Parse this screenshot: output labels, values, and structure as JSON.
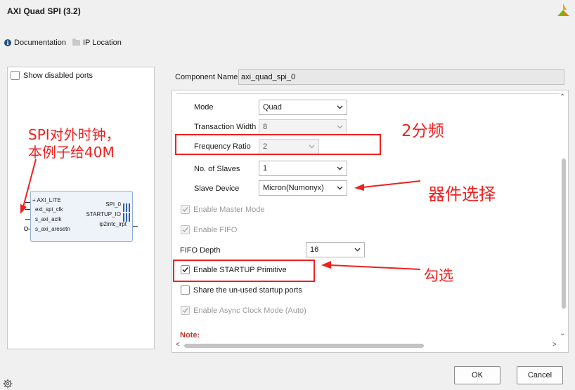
{
  "window": {
    "title": "AXI Quad SPI (3.2)"
  },
  "toplinks": {
    "documentation": "Documentation",
    "ip_location": "IP Location"
  },
  "left": {
    "show_disabled_ports": "Show disabled ports",
    "block": {
      "left_ports": [
        "AXI_LITE",
        "ext_spi_clk",
        "s_axi_aclk",
        "s_axi_aresetn"
      ],
      "right_ports": [
        "SPI_0",
        "STARTUP_IO",
        "ip2intc_irpt"
      ]
    }
  },
  "component": {
    "label": "Component Name",
    "value": "axi_quad_spi_0"
  },
  "form": {
    "mode": {
      "label": "Mode",
      "value": "Quad"
    },
    "transaction_width": {
      "label": "Transaction Width",
      "value": "8"
    },
    "frequency_ratio": {
      "label": "Frequency Ratio",
      "value": "2"
    },
    "no_of_slaves": {
      "label": "No. of Slaves",
      "value": "1"
    },
    "slave_device": {
      "label": "Slave Device",
      "value": "Micron(Numonyx)"
    },
    "enable_master_mode": {
      "label": "Enable Master Mode",
      "checked": true,
      "disabled": true
    },
    "enable_fifo": {
      "label": "Enable FIFO",
      "checked": true,
      "disabled": true
    },
    "fifo_depth": {
      "label": "FIFO Depth",
      "value": "16"
    },
    "enable_startup": {
      "label": "Enable STARTUP Primitive",
      "checked": true
    },
    "share_startup": {
      "label": "Share the un-used startup ports",
      "checked": false
    },
    "enable_async": {
      "label": "Enable Async Clock Mode (Auto)",
      "checked": true,
      "disabled": true
    },
    "note": "Note:"
  },
  "buttons": {
    "ok": "OK",
    "cancel": "Cancel"
  },
  "annotations": {
    "spi_clock": "SPI对外时钟，\n本例子给40M",
    "divide_by_2": "2分频",
    "device_select": "器件选择",
    "check": "勾选"
  },
  "colors": {
    "annotation": "#f02020",
    "accent": "#1f4e79"
  }
}
